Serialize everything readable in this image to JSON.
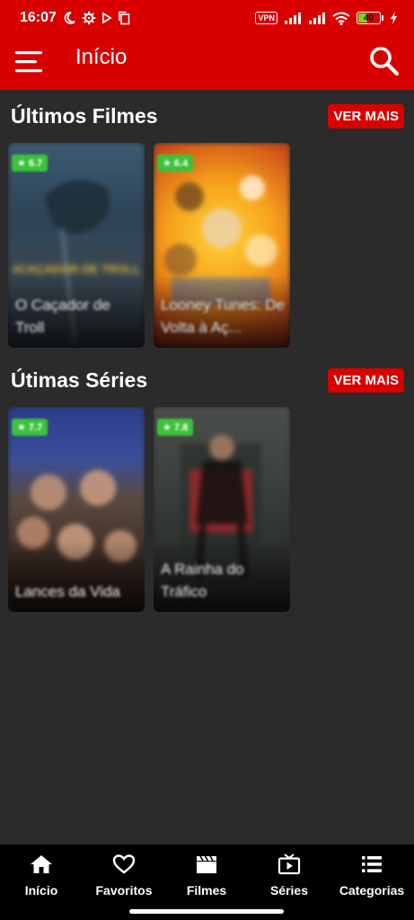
{
  "status_bar": {
    "time": "16:07",
    "vpn_label": "VPN",
    "battery_level": "40",
    "battery_fraction": 0.4,
    "icons": [
      "moon-icon",
      "settings-gear-icon",
      "play-icon",
      "copy-icon",
      "signal-icon",
      "signal-icon",
      "wifi-icon",
      "battery-icon",
      "charging-bolt-icon"
    ]
  },
  "app_bar": {
    "title": "Início",
    "menu_icon": "menu-icon",
    "search_icon": "search-icon"
  },
  "sections": [
    {
      "title": "Últimos Filmes",
      "more_label": "VER MAIS",
      "items": [
        {
          "title": "O Caçador de Troll",
          "rating": "★ 6.7",
          "poster_text": "#CAÇADOR DE TROLL"
        },
        {
          "title": "Looney Tunes: De Volta à Aç...",
          "rating": "★ 6.4"
        }
      ]
    },
    {
      "title": "Útimas Séries",
      "more_label": "VER MAIS",
      "items": [
        {
          "title": "Lances da Vida",
          "rating": "★ 7.7"
        },
        {
          "title": "A Rainha do Tráfico",
          "rating": "★ 7.8"
        }
      ]
    }
  ],
  "bottom_nav": [
    {
      "label": "Início",
      "icon": "home-icon"
    },
    {
      "label": "Favoritos",
      "icon": "heart-icon"
    },
    {
      "label": "Filmes",
      "icon": "clapperboard-icon"
    },
    {
      "label": "Séries",
      "icon": "tv-play-icon"
    },
    {
      "label": "Categorias",
      "icon": "list-icon"
    }
  ],
  "colors": {
    "accent": "#d90000",
    "background": "#2b2b2b",
    "rating_badge": "#3ec13a",
    "nav_background": "#000000"
  }
}
